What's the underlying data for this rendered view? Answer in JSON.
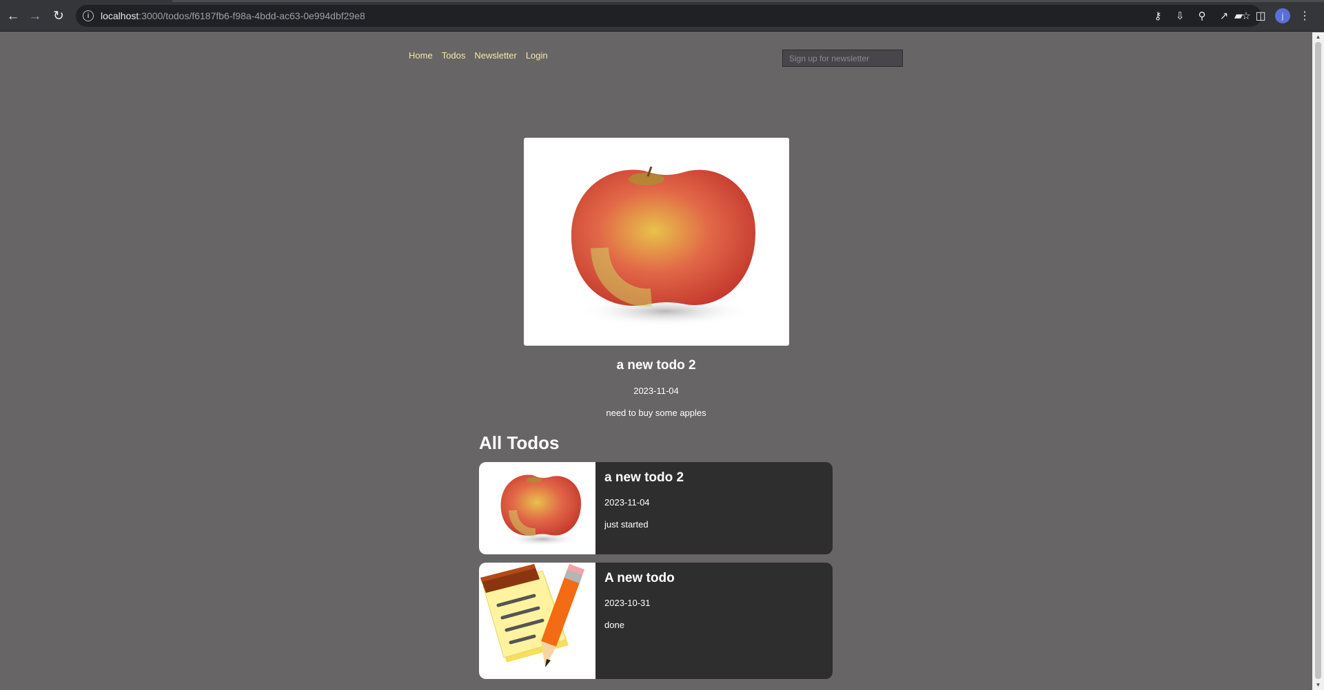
{
  "browser": {
    "url_host": "localhost",
    "url_path": ":3000/todos/f6187fb6-f98a-4bdd-ac63-0e994dbf29e8",
    "profile_initial": "j"
  },
  "nav": {
    "links": [
      "Home",
      "Todos",
      "Newsletter",
      "Login"
    ],
    "link_color": "#f5e9a6"
  },
  "newsletter": {
    "placeholder": "Sign up for newsletter"
  },
  "detail": {
    "image_icon": "apple",
    "title": "a new todo 2",
    "date": "2023-11-04",
    "description": "need to buy some apples"
  },
  "all_todos": {
    "heading": "All Todos",
    "items": [
      {
        "image_icon": "apple",
        "title": "a new todo 2",
        "date": "2023-11-04",
        "status": "just started"
      },
      {
        "image_icon": "notepad-pencil",
        "title": "A new todo",
        "date": "2023-10-31",
        "status": "done"
      }
    ]
  },
  "colors": {
    "page_bg": "#676566",
    "card_bg": "#2f2e2e"
  }
}
